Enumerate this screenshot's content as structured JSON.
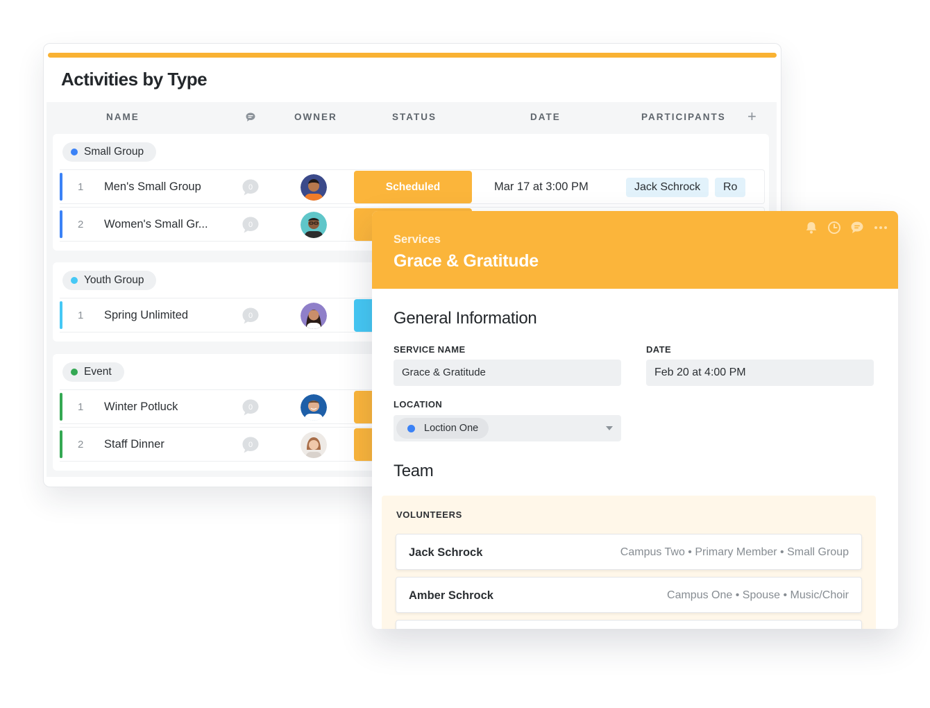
{
  "colors": {
    "accent": "#f9b233",
    "status_orange": "#fbb53b",
    "small_group": "#3b82f6",
    "youth_group": "#45c8f5",
    "event": "#34a853",
    "participant_tag": "#e2f2fb"
  },
  "board": {
    "title": "Activities by Type",
    "columns": {
      "name": "NAME",
      "comments_icon": "comment-icon",
      "owner": "OWNER",
      "status": "STATUS",
      "date": "DATE",
      "participants": "PARTICIPANTS",
      "add": "+"
    },
    "groups": [
      {
        "label": "Small Group",
        "color": "#3b82f6",
        "rows": [
          {
            "num": "1",
            "name": "Men's Small Group",
            "comments": "0",
            "owner_avatar": "avatar-man-orange-shirt",
            "status": "Scheduled",
            "date": "Mar 17 at 3:00 PM",
            "participants": [
              "Jack Schrock",
              "Ro"
            ]
          },
          {
            "num": "2",
            "name": "Women's Small Gr...",
            "comments": "0",
            "owner_avatar": "avatar-man-glasses"
          }
        ]
      },
      {
        "label": "Youth Group",
        "color": "#45c8f5",
        "rows": [
          {
            "num": "1",
            "name": "Spring Unlimited",
            "comments": "0",
            "owner_avatar": "avatar-woman-dark-hair"
          }
        ]
      },
      {
        "label": "Event",
        "color": "#34a853",
        "rows": [
          {
            "num": "1",
            "name": "Winter Potluck",
            "comments": "0",
            "owner_avatar": "avatar-man-smiling"
          },
          {
            "num": "2",
            "name": "Staff Dinner",
            "comments": "0",
            "owner_avatar": "avatar-woman-short-hair"
          }
        ]
      }
    ]
  },
  "detail": {
    "kicker": "Services",
    "title": "Grace & Gratitude",
    "header_icons": [
      "bell-icon",
      "clock-icon",
      "comment-icon",
      "more-icon"
    ],
    "general": {
      "title": "General Information",
      "service_name_label": "SERVICE NAME",
      "service_name_value": "Grace & Gratitude",
      "date_label": "DATE",
      "date_value": "Feb 20 at 4:00 PM",
      "location_label": "LOCATION",
      "location_value": "Loction One"
    },
    "team": {
      "title": "Team",
      "volunteers_label": "VOLUNTEERS",
      "volunteers": [
        {
          "name": "Jack Schrock",
          "meta": "Campus Two • Primary Member • Small Group"
        },
        {
          "name": "Amber Schrock",
          "meta": "Campus One • Spouse • Music/Choir"
        }
      ]
    }
  }
}
